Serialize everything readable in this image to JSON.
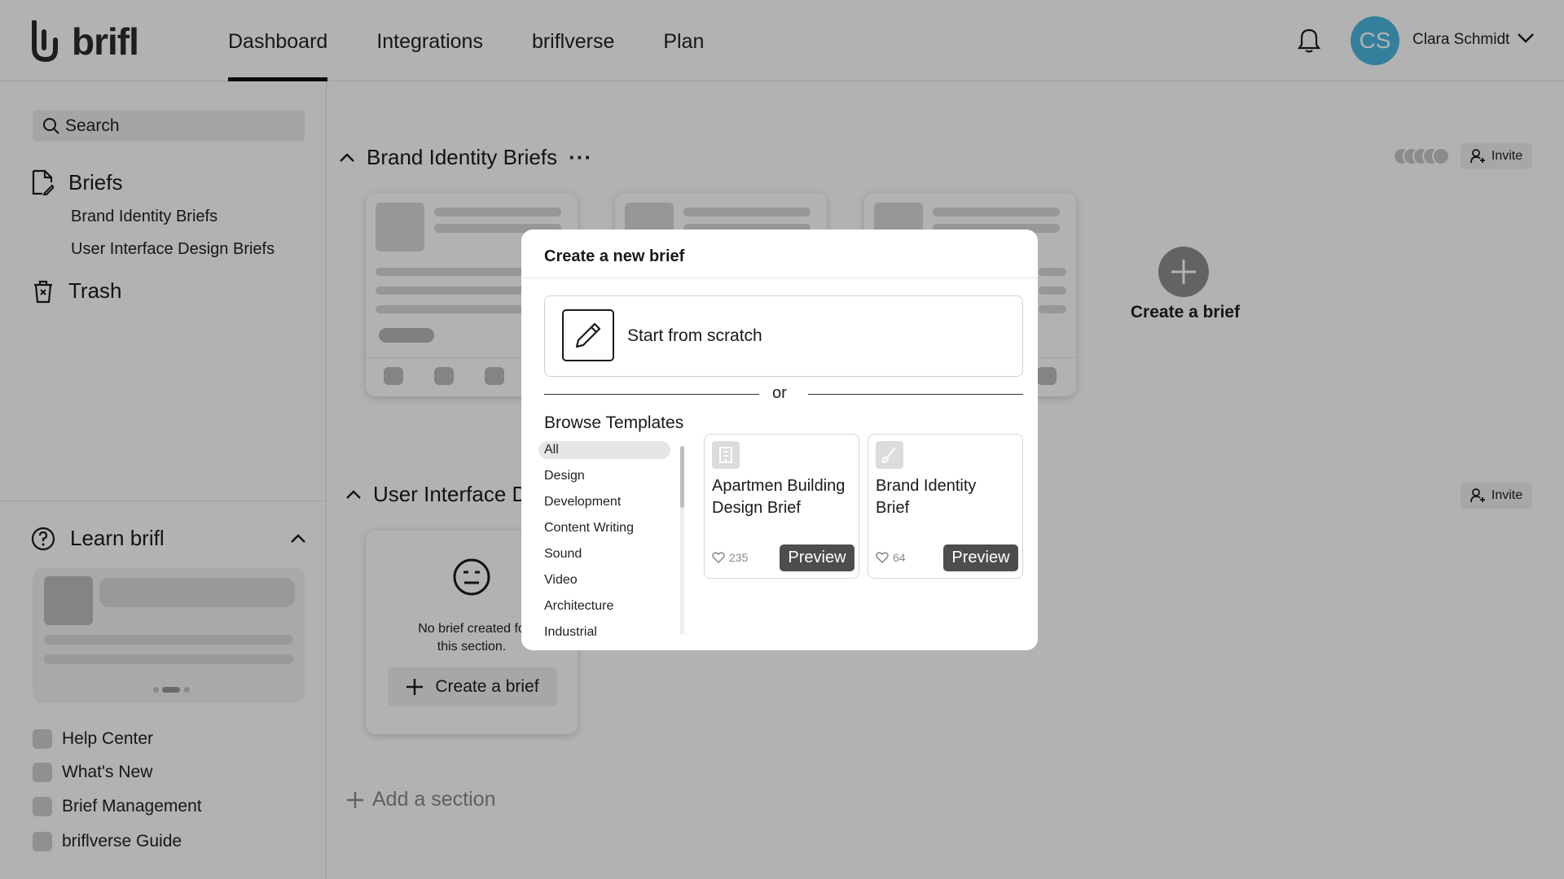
{
  "app": {
    "logo_text": "brifl"
  },
  "nav": {
    "items": [
      "Dashboard",
      "Integrations",
      "briflverse",
      "Plan"
    ],
    "active": "Dashboard"
  },
  "user": {
    "initials": "CS",
    "name": "Clara Schmidt",
    "avatar_color": "#4bb8e0"
  },
  "sidebar": {
    "search_placeholder": "Search",
    "briefs_label": "Briefs",
    "brief_sections": [
      "Brand Identity Briefs",
      "User Interface Design Briefs"
    ],
    "trash_label": "Trash",
    "learn_label": "Learn brifl",
    "links": [
      "Help Center",
      "What's New",
      "Brief Management",
      "briflverse Guide"
    ]
  },
  "main": {
    "section1_title": "Brand Identity Briefs",
    "section1_more": "···",
    "invite_label": "Invite",
    "create_brief_label": "Create a brief",
    "section2_title": "User Interface D",
    "empty_text_line1": "No brief created fo",
    "empty_text_line2": "this section.",
    "empty_create_label": "Create a brief",
    "add_section_label": "Add a section"
  },
  "modal": {
    "title": "Create a new brief",
    "scratch_label": "Start from scratch",
    "or_label": "or",
    "browse_label": "Browse Templates",
    "categories": [
      "All",
      "Design",
      "Development",
      "Content Writing",
      "Sound",
      "Video",
      "Architecture",
      "Industrial"
    ],
    "selected_category": "All",
    "templates": [
      {
        "title": "Apartmen Building Design Brief",
        "likes": "235",
        "preview_label": "Preview",
        "icon": "building-icon"
      },
      {
        "title": "Brand Identity Brief",
        "likes": "64",
        "preview_label": "Preview",
        "icon": "brush-icon"
      }
    ]
  }
}
